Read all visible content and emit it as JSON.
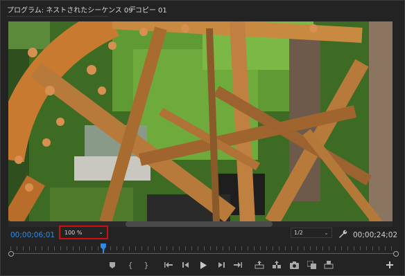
{
  "header": {
    "title": "プログラム: ネストされたシーケンス 09 コピー 01",
    "menu_icon": "hamburger-icon"
  },
  "controls": {
    "current_timecode": "00;00;06;01",
    "zoom_level": "100 %",
    "resolution": "1/2",
    "duration_timecode": "00;00;24;02"
  },
  "playhead_position": 0.24,
  "transport": [
    "add-marker",
    "mark-in",
    "mark-out",
    "go-to-in",
    "step-back",
    "play",
    "step-forward",
    "go-to-out",
    "lift",
    "extract",
    "export-frame",
    "comparison-view",
    "trim-mode",
    "add-button"
  ],
  "colors": {
    "accent": "#2d8ceb",
    "highlight_box": "#d01010",
    "panel_bg": "#232323"
  }
}
